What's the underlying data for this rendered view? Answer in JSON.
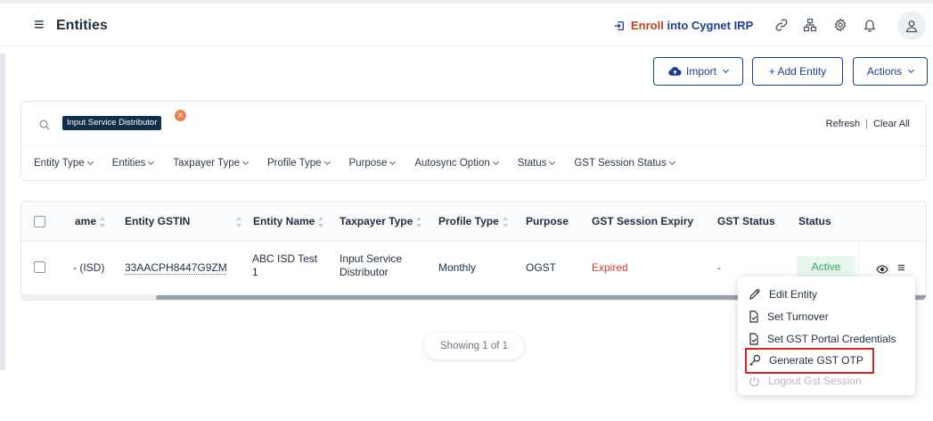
{
  "header": {
    "title": "Entities",
    "enroll_prefix": "Enroll",
    "enroll_suffix": "into Cygnet IRP"
  },
  "toolbar": {
    "import_label": "Import",
    "add_entity_label": "+ Add Entity",
    "actions_label": "Actions"
  },
  "search": {
    "chip_label": "Input Service Distributor",
    "refresh_label": "Refresh",
    "separator": "|",
    "clear_all_label": "Clear All"
  },
  "filters": [
    "Entity Type",
    "Entities",
    "Taxpayer Type",
    "Profile Type",
    "Purpose",
    "Autosync Option",
    "Status",
    "GST Session Status"
  ],
  "table": {
    "columns": {
      "name": "ame",
      "gstin": "Entity GSTIN",
      "entity_name": "Entity Name",
      "taxpayer_type": "Taxpayer Type",
      "profile_type": "Profile Type",
      "purpose": "Purpose",
      "session_expiry": "GST Session Expiry",
      "gst_status": "GST Status",
      "status": "Status"
    },
    "row": {
      "name": "- (ISD)",
      "gstin": "33AACPH8447G9ZM",
      "entity_name": "ABC ISD Test 1",
      "taxpayer_type": "Input Service Distributor",
      "profile_type": "Monthly",
      "purpose": "OGST",
      "session_expiry": "Expired",
      "gst_status": "-",
      "status": "Active"
    }
  },
  "pagination": {
    "showing": "Showing 1 of 1"
  },
  "context_menu": {
    "edit_entity": "Edit Entity",
    "set_turnover": "Set Turnover",
    "set_portal_credentials": "Set GST Portal Credentials",
    "generate_otp": "Generate GST OTP",
    "logout_session": "Logout Gst Session"
  },
  "colors": {
    "primary": "#1b3f8f",
    "enroll_accent": "#c2411f",
    "expired": "#d63a2f",
    "active_text": "#2eaa5c",
    "active_bg": "#e7f7ec",
    "highlight_border": "#e02020"
  }
}
